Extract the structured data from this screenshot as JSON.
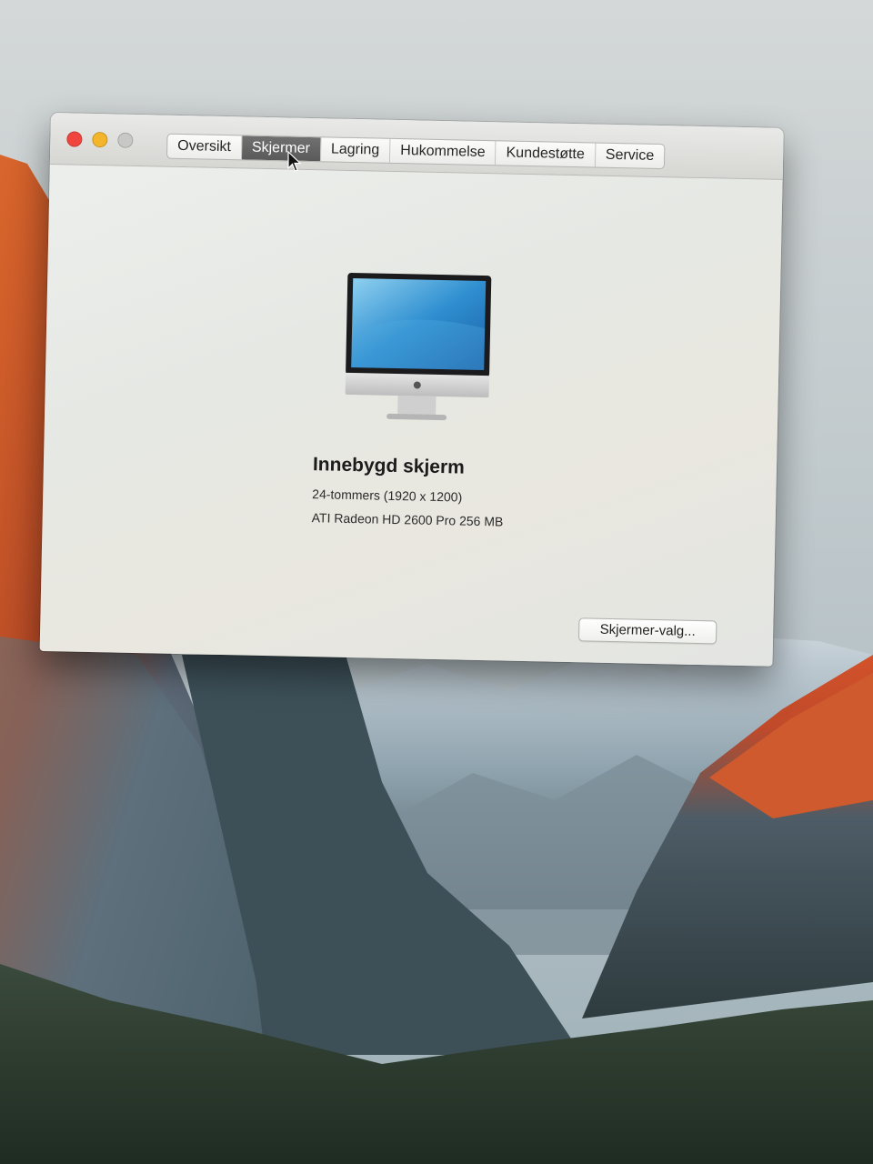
{
  "window": {
    "tabs": [
      {
        "label": "Oversikt"
      },
      {
        "label": "Skjermer"
      },
      {
        "label": "Lagring"
      },
      {
        "label": "Hukommelse"
      },
      {
        "label": "Kundestøtte"
      },
      {
        "label": "Service"
      }
    ],
    "active_tab": "Skjermer"
  },
  "display": {
    "name": "Innebygd skjerm",
    "resolution": "24-tommers (1920 x 1200)",
    "graphics": "ATI Radeon HD 2600 Pro 256 MB",
    "prefs_button_label": "Skjermer-valg...",
    "icon": "imac-icon"
  },
  "colors": {
    "close": "#f0453f",
    "minimize": "#f3b52b",
    "zoom_disabled": "#c8c8c6",
    "active_tab": "#5f5f5f"
  }
}
